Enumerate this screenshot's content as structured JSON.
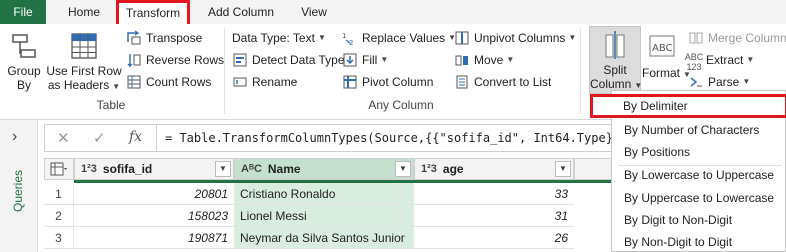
{
  "tabs": {
    "file": "File",
    "home": "Home",
    "transform": "Transform",
    "add_column": "Add Column",
    "view": "View"
  },
  "ribbon": {
    "table_group": {
      "label": "Table",
      "group_by": [
        "Group",
        "By"
      ],
      "first_row_headers": [
        "Use First Row",
        "as Headers"
      ],
      "transpose": "Transpose",
      "reverse_rows": "Reverse Rows",
      "count_rows": "Count Rows"
    },
    "any_column_group": {
      "label": "Any Column",
      "data_type": "Data Type: Text",
      "detect_data_type": "Detect Data Type",
      "rename": "Rename",
      "replace_values": "Replace Values",
      "fill": "Fill",
      "pivot_column": "Pivot Column",
      "unpivot_columns": "Unpivot Columns",
      "move": "Move",
      "convert_to_list": "Convert to List"
    },
    "text_column_group": {
      "split_column": [
        "Split",
        "Column"
      ],
      "format": "Format",
      "merge_columns": "Merge Columns",
      "extract": "Extract",
      "parse": "Parse",
      "abc_123": [
        "ABC",
        "123"
      ]
    }
  },
  "queries_label": "Queries",
  "formula_bar": {
    "formula": "= Table.TransformColumnTypes(Source,{{\"sofifa_id\", Int64.Type},",
    "fx": "fx"
  },
  "grid": {
    "columns": [
      {
        "type_badge": "1²3",
        "name": "sofifa_id"
      },
      {
        "type_badge": "AᴮC",
        "name": "Name"
      },
      {
        "type_badge": "1²3",
        "name": "age"
      }
    ],
    "rows": [
      {
        "n": "1",
        "sofifa_id": "20801",
        "name": "Cristiano Ronaldo",
        "age": "33"
      },
      {
        "n": "2",
        "sofifa_id": "158023",
        "name": "Lionel Messi",
        "age": "31"
      },
      {
        "n": "3",
        "sofifa_id": "190871",
        "name": "Neymar da Silva Santos Junior",
        "age": "26"
      }
    ]
  },
  "split_menu": {
    "items": [
      "By Delimiter",
      "By Number of Characters",
      "By Positions",
      "By Lowercase to Uppercase",
      "By Uppercase to Lowercase",
      "By Digit to Non-Digit",
      "By Non-Digit to Digit"
    ]
  },
  "colors": {
    "accent_green": "#217346",
    "highlight_red": "#e1161f",
    "selected_column": "#d8ecdf"
  }
}
